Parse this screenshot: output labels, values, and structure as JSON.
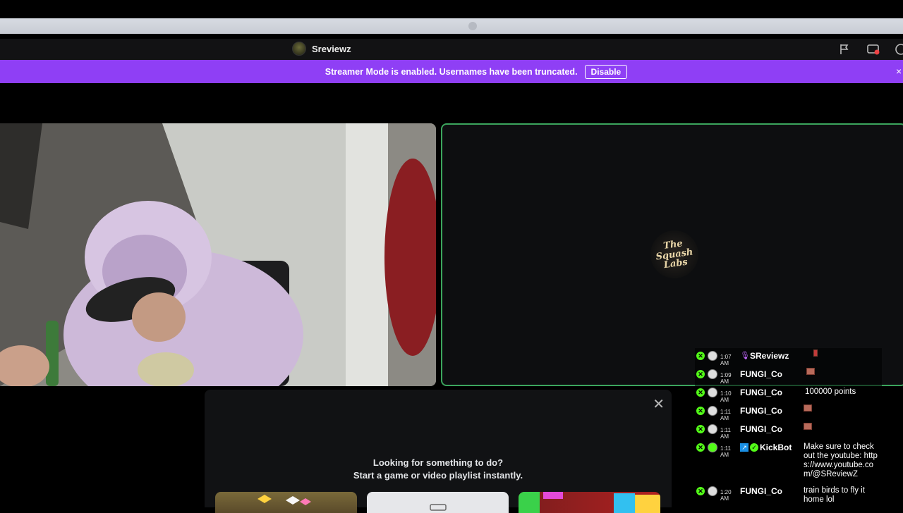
{
  "window": {
    "title": "Sreviewz"
  },
  "toolbar": {
    "icons": [
      "flag-icon",
      "screen-share-icon",
      "help-icon"
    ]
  },
  "banner": {
    "message": "Streamer Mode is enabled. Usernames have been truncated.",
    "button_label": "Disable",
    "close_glyph": "×",
    "color": "#8f3ff5"
  },
  "stream": {
    "logo_text": "The Squash Labs",
    "border_color": "#3ba55d"
  },
  "chat": {
    "messages": [
      {
        "time": "1:07 AM",
        "user": "SReviewz",
        "text": "",
        "badge": "mic",
        "emote": true
      },
      {
        "time": "1:09 AM",
        "user": "FUNGI_Co",
        "text": "",
        "emote": true
      },
      {
        "time": "1:10 AM",
        "user": "FUNGI_Co",
        "text": "100000 points",
        "emote": false
      },
      {
        "time": "1:11 AM",
        "user": "FUNGI_Co",
        "text": "",
        "emote": true
      },
      {
        "time": "1:11 AM",
        "user": "FUNGI_Co",
        "text": "",
        "emote": true
      },
      {
        "time": "1:11 AM",
        "user": "KickBot",
        "text": "Make sure to check out the youtube: https://www.youtube.com/@SReviewZ",
        "badge": "bot",
        "emote": false
      },
      {
        "time": "1:20 AM",
        "user": "FUNGI_Co",
        "text": "train birds to fly it home lol",
        "emote": false
      }
    ]
  },
  "activity": {
    "line1": "Looking for something to do?",
    "line2": "Start a game or video playlist instantly.",
    "close_glyph": "✕"
  }
}
